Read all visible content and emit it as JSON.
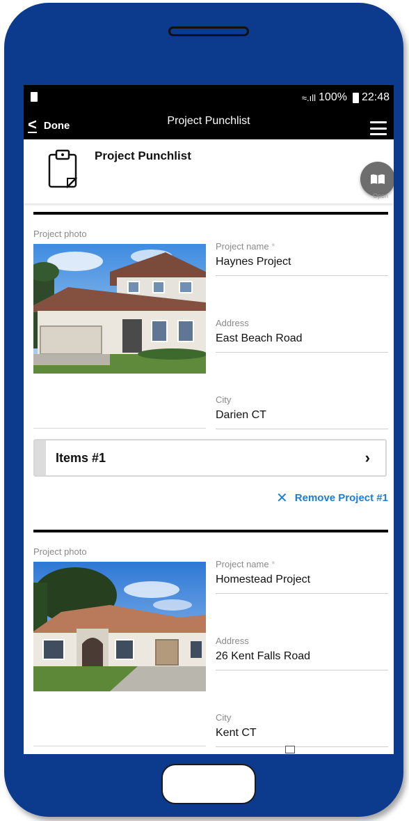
{
  "status_bar": {
    "battery": "100%",
    "time": "22:48"
  },
  "app_bar": {
    "back_label": "Done",
    "title": "Project Punchlist"
  },
  "header": {
    "title": "Project Punchlist",
    "fab_label": "Open"
  },
  "projects": [
    {
      "photo_label": "Project photo",
      "name_label": "Project name",
      "required_mark": "*",
      "name": "Haynes Project",
      "address_label": "Address",
      "address": "East Beach Road",
      "city_label": "City",
      "city": "Darien CT",
      "items_label": "Items #1",
      "remove_label": "Remove Project #1"
    },
    {
      "photo_label": "Project photo",
      "name_label": "Project name",
      "required_mark": "*",
      "name": "Homestead Project",
      "address_label": "Address",
      "address": "26 Kent Falls Road",
      "city_label": "City",
      "city": "Kent CT"
    }
  ],
  "colors": {
    "phone_frame": "#0c3a8c",
    "accent_link": "#1b7dd6"
  }
}
